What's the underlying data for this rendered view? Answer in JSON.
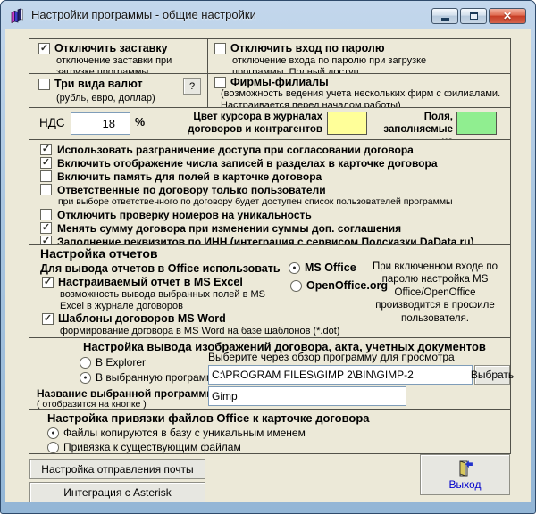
{
  "titlebar": {
    "title": "Настройки программы - общие настройки"
  },
  "icons": {
    "app": "books",
    "minimize": "minimize-bar",
    "maximize": "restore-box",
    "close": "✕",
    "help": "?",
    "exit": "open-door-arrow",
    "check": "✓",
    "dot": "●"
  },
  "opts": {
    "splash": {
      "label": "Отключить заставку",
      "mark": "✓",
      "desc": "отключение заставки при загрузке программы"
    },
    "password": {
      "label": "Отключить вход по паролю",
      "mark": "",
      "desc": "отключение входа по паролю при загрузке программы. Полный доступ."
    },
    "currency": {
      "label": "Три вида валют",
      "mark": "",
      "help": "?",
      "desc": "(рубль, евро, доллар)"
    },
    "firms": {
      "label": "Фирмы-филиалы",
      "mark": "",
      "desc": "(возможность ведения учета нескольких фирм с филиалами. Настраивается перед началом работы)"
    }
  },
  "vat": {
    "label": "НДС",
    "value": "18",
    "percent": "%",
    "cursor_label": "Цвет курсора в журналах договоров и контрагентов",
    "cursor_color": "#ffff99",
    "fields_label": "Поля, заполняемые из справочников",
    "fields_color": "#90ee90"
  },
  "checklist": [
    {
      "label": "Использовать разграничение доступа при согласовании договора",
      "mark": "✓"
    },
    {
      "label": "Включить отображение числа записей в разделах в карточке договора",
      "mark": "✓"
    },
    {
      "label": "Включить память для полей в карточке договора",
      "mark": ""
    },
    {
      "label": "Ответственные по договору только пользователи",
      "mark": "",
      "note": "при выборе ответственного по договору будет доступен  список пользователей программы"
    },
    {
      "label": "Отключить проверку номеров на уникальность",
      "mark": ""
    },
    {
      "label": "Менять сумму договора при изменении суммы доп. соглашения",
      "mark": "✓"
    },
    {
      "label": "Заполнение реквизитов по ИНН (интеграция с сервисом Подсказки DaData.ru)",
      "mark": "✓"
    }
  ],
  "reports": {
    "title": "Настройка отчетов",
    "office_label": "Для вывода отчетов в Office использовать",
    "ms": {
      "label": "MS Office",
      "mark": "●"
    },
    "oo": {
      "label": "OpenOffice.org",
      "mark": ""
    },
    "excel": {
      "label": "Настраиваемый отчет в MS Excel",
      "mark": "✓",
      "desc": "возможность вывода выбранных полей в MS Excel в журнале договоров"
    },
    "word": {
      "label": "Шаблоны договоров MS Word",
      "mark": "✓",
      "desc": "формирование договора в MS Word на базе шаблонов (*.dot)"
    },
    "note": "При включенном входе по паролю настройка MS Office/OpenOffice производится в профиле пользователя."
  },
  "images": {
    "title": "Настройка вывода изображений договора,  акта, учетных документов",
    "explorer": {
      "label": "В Explorer",
      "mark": ""
    },
    "program": {
      "label": "В выбранную программу",
      "mark": "●"
    },
    "browse_label": "Выберите через обзор программу для просмотра",
    "path": "C:\\PROGRAM FILES\\GIMP 2\\BIN\\GIMP-2",
    "browse_button": "Выбрать",
    "name_label": "Название выбранной программы",
    "name_sub": "( отобразится на кнопке )",
    "name_value": "Gimp"
  },
  "binding": {
    "title": "Настройка привязки файлов Office к карточке договора",
    "copy": {
      "label": "Файлы копируются в базу с уникальным именем",
      "mark": "●"
    },
    "link": {
      "label": "Привязка к существующим файлам",
      "mark": ""
    }
  },
  "footer": {
    "mail_button": "Настройка отправления почты",
    "asterisk_button": "Интеграция с Asterisk",
    "exit_button": "Выход"
  }
}
